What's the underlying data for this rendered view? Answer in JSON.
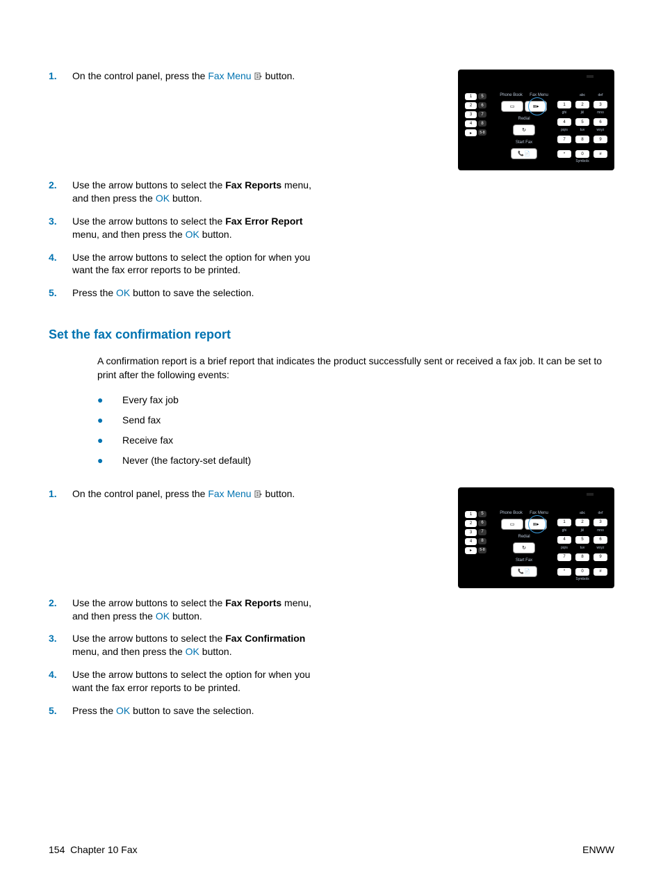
{
  "stepsA": [
    {
      "num": "1.",
      "pre": "On the control panel, press the ",
      "link": "Fax Menu",
      "icon": true,
      "post": " button."
    },
    {
      "num": "2.",
      "pre": "Use the arrow buttons to select the ",
      "bold": "Fax Reports",
      "mid": " menu, and then press the ",
      "link": "OK",
      "post": " button."
    },
    {
      "num": "3.",
      "pre": "Use the arrow buttons to select the ",
      "bold": "Fax Error Report",
      "mid": " menu, and then press the ",
      "link": "OK",
      "post": " button."
    },
    {
      "num": "4.",
      "pre": "Use the arrow buttons to select the option for when you want the fax error reports to be printed."
    },
    {
      "num": "5.",
      "pre": "Press the ",
      "link": "OK",
      "post": " button to save the selection."
    }
  ],
  "sectionHeading": "Set the fax confirmation report",
  "intro": "A confirmation report is a brief report that indicates the product successfully sent or received a fax job. It can be set to print after the following events:",
  "bullets": [
    "Every fax job",
    "Send fax",
    "Receive fax",
    "Never (the factory-set default)"
  ],
  "stepsB": [
    {
      "num": "1.",
      "pre": "On the control panel, press the ",
      "link": "Fax Menu",
      "icon": true,
      "post": " button."
    },
    {
      "num": "2.",
      "pre": "Use the arrow buttons to select the ",
      "bold": "Fax Reports",
      "mid": " menu, and then press the ",
      "link": "OK",
      "post": " button."
    },
    {
      "num": "3.",
      "pre": "Use the arrow buttons to select the ",
      "bold": "Fax Confirmation",
      "mid": " menu, and then press the ",
      "link": "OK",
      "post": " button."
    },
    {
      "num": "4.",
      "pre": "Use the arrow buttons to select the option for when you want the fax error reports to be printed."
    },
    {
      "num": "5.",
      "pre": "Press the ",
      "link": "OK",
      "post": " button to save the selection."
    }
  ],
  "panel": {
    "midLabels": [
      "Phone Book",
      "Fax Menu",
      "Redial",
      "Start Fax"
    ],
    "padTopLabels": [
      "",
      "abc",
      "def"
    ],
    "padLabels2": [
      "ghi",
      "jkl",
      "mno"
    ],
    "padLabels3": [
      "pqrs",
      "tuv",
      "wxyz"
    ],
    "padBottomLabel": "Symbols"
  },
  "footer": {
    "page": "154",
    "chapter": "Chapter 10   Fax",
    "right": "ENWW"
  }
}
